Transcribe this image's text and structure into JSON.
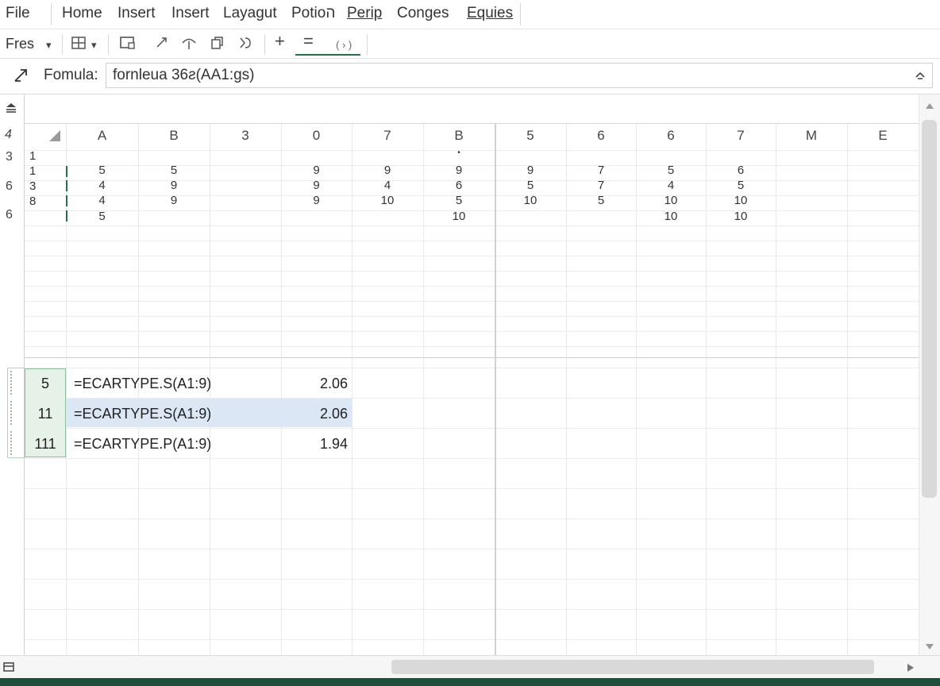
{
  "menu": {
    "items": [
      "File",
      "Home",
      "Insert",
      "Insert",
      "Layagut",
      "Potioה",
      "Perip",
      "Conges",
      "Equies"
    ]
  },
  "toolbar": {
    "font_name": "Fres",
    "dropdown_glyph": "▾",
    "plus_glyph": "+",
    "equals_glyph": "=",
    "paren_glyph": "( › )"
  },
  "formula_bar": {
    "label": "Fomula:",
    "value": "fornleua 36ƨ(AA1:gs)"
  },
  "gutter": {
    "row_nums": [
      "4",
      "3",
      "6",
      "6"
    ]
  },
  "grid": {
    "column_headers": [
      "A",
      "B",
      "3",
      "0",
      "7",
      "B",
      "5",
      "6",
      "6",
      "7",
      "M",
      "E"
    ],
    "row_numbers": [
      "1",
      "1",
      "3",
      "8"
    ],
    "data_rows": [
      [
        "5",
        "5",
        "",
        "9",
        "9",
        "9",
        "9",
        "7",
        "5",
        "6"
      ],
      [
        "4",
        "9",
        "",
        "9",
        "4",
        "6",
        "5",
        "7",
        "4",
        "5"
      ],
      [
        "4",
        "9",
        "",
        "9",
        "10",
        "5",
        "10",
        "5",
        "10",
        "10"
      ],
      [
        "5",
        "",
        "",
        "",
        "",
        "10",
        "",
        "",
        "10",
        "10"
      ]
    ],
    "dot_mark": "•"
  },
  "results": [
    {
      "row": "5",
      "formula": "=ECARTYPE.S(A1:9)",
      "value": "2.06"
    },
    {
      "row": "11",
      "formula": "=ECARTYPE.S(A1:9)",
      "value": "2.06"
    },
    {
      "row": "111",
      "formula": "=ECARTYPE.P(A1:9)",
      "value": "1.94"
    }
  ],
  "colors": {
    "accent_green": "#217346",
    "status_bar": "#1f4e3d",
    "selection_blue": "#dbe7f5",
    "selection_green": "#e6f2e8"
  }
}
